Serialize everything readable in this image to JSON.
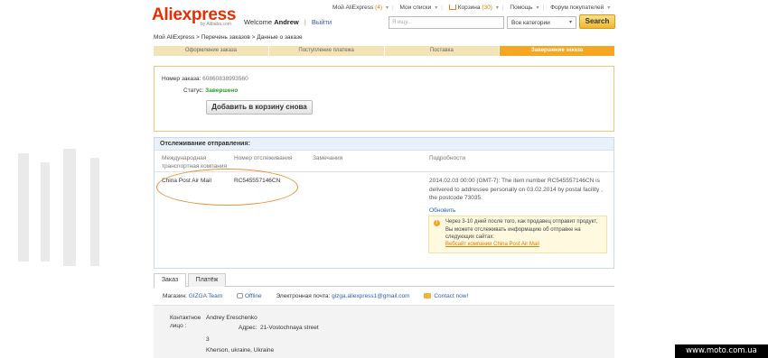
{
  "brand": {
    "logo_ali": "Ali",
    "logo_express": "express",
    "logo_sub": "by Alibaba.com",
    "logo_color": "#e62e04"
  },
  "header": {
    "welcome": "Welcome",
    "user": "Andrew",
    "sep": "|",
    "logout": "Выйти"
  },
  "topnav": {
    "my_aliexpress": "Мой AliExpress",
    "my_aliexpress_count": "(4)",
    "my_lists": "Мои списки",
    "cart": "Корзина",
    "cart_count": "(30)",
    "help": "Помощь",
    "forum": "Форум покупателей"
  },
  "search": {
    "placeholder": "Я ищу...",
    "category": "Все категории",
    "button": "Search"
  },
  "breadcrumb": "Мой AliExpress > Перечень заказов > Данные о заказе",
  "steps": [
    {
      "label": "Оформление заказа",
      "active": false
    },
    {
      "label": "Поступление платежа",
      "active": false
    },
    {
      "label": "Поставка",
      "active": false
    },
    {
      "label": "Завершение заказа",
      "active": true
    }
  ],
  "order": {
    "number_label": "Номер заказа:",
    "number": "60860838993560",
    "status_label": "Статус:",
    "status": "Завершено",
    "status_color": "#2c9a2c",
    "reorder_button": "Добавить в корзину снова"
  },
  "tracking": {
    "title": "Отслеживание отправления:",
    "columns": {
      "carrier": "Международная транспортная компания",
      "number": "Номер отслеживания",
      "remarks": "Замечания",
      "details": "Подробности"
    },
    "carrier": "China Post Air Mail",
    "tracking_number": "RC545557146CN",
    "remarks": "",
    "details": "2014.02.03 00:00 (GMT-7): The item number RC545557146CN is delivered to addressee personally on 03.02.2014 by postal facility , the postcode 73035.",
    "refresh": "Обновить",
    "note": "Через 3-10 дней после того, как продавец отправит продукт, Вы можете отслеживать информацию об отправке на следующих сайтах:",
    "note_link": "Вебсайт компании China Post Air Mail",
    "highlight_color": "#e8913a"
  },
  "tabs": [
    {
      "label": "Заказ",
      "active": true
    },
    {
      "label": "Платёж",
      "active": false
    }
  ],
  "store": {
    "store_label": "Магазин:",
    "store_name": "GIZGA Team",
    "offline": "Offline",
    "email_label": "Электронная почта:",
    "email": "gizga.aliexpress1@gmail.com",
    "contact": "Contact now!"
  },
  "contact": {
    "person_label": "Контактное лицо :",
    "person": "Andrey Ereschenko",
    "address_label": "Адрес:",
    "address_line1": "21-Vostochnaya street",
    "address_line2": "3",
    "address_line3": "Kherson, ukraine, Ukraine"
  },
  "watermark": "www.moto.com.ua"
}
